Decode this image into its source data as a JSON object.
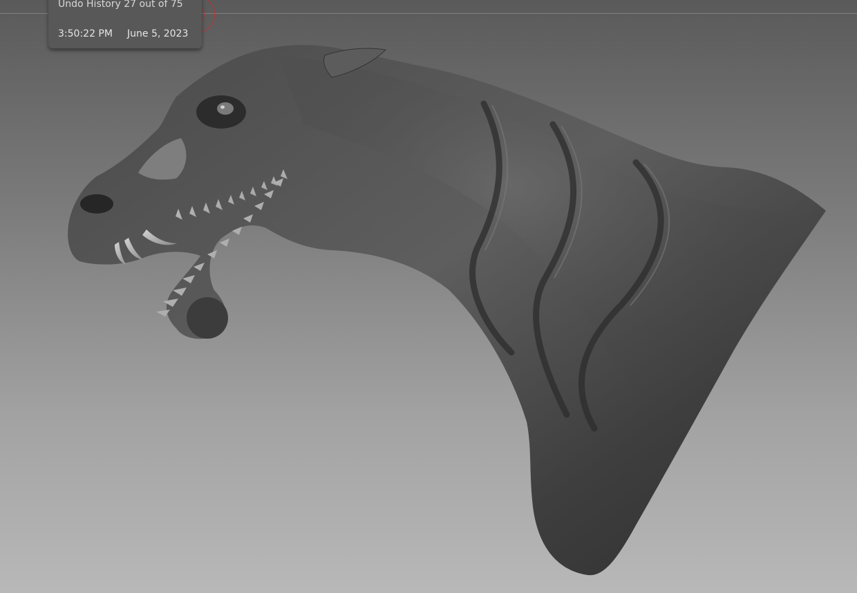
{
  "tooltip": {
    "history": "Undo History 27 out of 75",
    "time": "3:50:22 PM",
    "date": "June 5, 2023"
  },
  "undo": {
    "current": 27,
    "total": 75
  },
  "colors": {
    "background_top": "#5a5a5a",
    "background_bottom": "#b8b8b8",
    "brush_cursor": "#b33333",
    "tooltip_bg": "#585858"
  }
}
